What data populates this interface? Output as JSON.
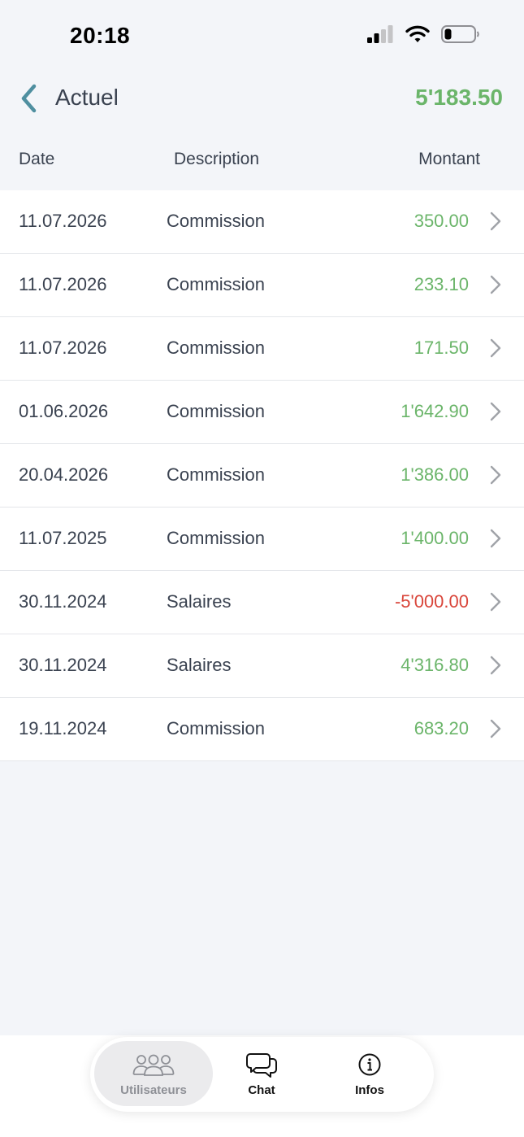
{
  "status": {
    "time": "20:18"
  },
  "header": {
    "title": "Actuel",
    "total": "5'183.50"
  },
  "columns": {
    "date": "Date",
    "description": "Description",
    "amount": "Montant"
  },
  "transactions": [
    {
      "date": "11.07.2026",
      "description": "Commission",
      "amount": "350.00"
    },
    {
      "date": "11.07.2026",
      "description": "Commission",
      "amount": "233.10"
    },
    {
      "date": "11.07.2026",
      "description": "Commission",
      "amount": "171.50"
    },
    {
      "date": "01.06.2026",
      "description": "Commission",
      "amount": "1'642.90"
    },
    {
      "date": "20.04.2026",
      "description": "Commission",
      "amount": "1'386.00"
    },
    {
      "date": "11.07.2025",
      "description": "Commission",
      "amount": "1'400.00"
    },
    {
      "date": "30.11.2024",
      "description": "Salaires",
      "amount": "-5'000.00"
    },
    {
      "date": "30.11.2024",
      "description": "Salaires",
      "amount": "4'316.80"
    },
    {
      "date": "19.11.2024",
      "description": "Commission",
      "amount": "683.20"
    }
  ],
  "tabs": [
    {
      "label": "Utilisateurs",
      "icon": "users-icon",
      "active": true
    },
    {
      "label": "Chat",
      "icon": "chat-icon",
      "active": false
    },
    {
      "label": "Infos",
      "icon": "info-icon",
      "active": false
    }
  ],
  "colors": {
    "positive": "#6bb56a",
    "negative": "#d9453a",
    "accent": "#4f8fa0"
  }
}
